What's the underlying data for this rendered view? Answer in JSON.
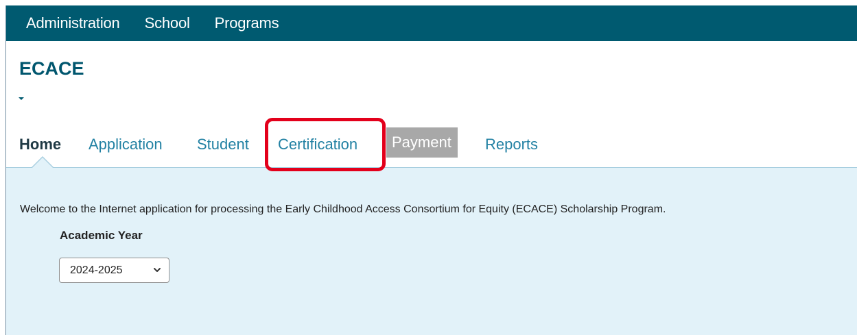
{
  "topnav": {
    "items": [
      {
        "label": "Administration"
      },
      {
        "label": "School"
      },
      {
        "label": "Programs"
      }
    ]
  },
  "app": {
    "title": "ECACE"
  },
  "tabs": {
    "items": [
      {
        "label": "Home",
        "state": "active"
      },
      {
        "label": "Application",
        "state": "normal"
      },
      {
        "label": "Student",
        "state": "normal"
      },
      {
        "label": "Certification",
        "state": "highlighted"
      },
      {
        "label": "Payment",
        "state": "disabled"
      },
      {
        "label": "Reports",
        "state": "normal"
      }
    ]
  },
  "main": {
    "welcome_text": "Welcome to the Internet application for processing the Early Childhood Access Consortium for Equity (ECACE) Scholarship Program.",
    "academic_year_label": "Academic Year",
    "academic_year_value": "2024-2025"
  },
  "colors": {
    "topbar": "#005a70",
    "title": "#00566e",
    "tab_link": "#2281a3",
    "tab_active": "#1f3944",
    "tab_disabled_bg": "#a8a8a8",
    "content_bg": "#e2f2f9",
    "highlight": "#e3001b"
  },
  "icons": {
    "menu_toggle": "caret-down-icon",
    "select_arrow": "chevron-down-icon"
  }
}
